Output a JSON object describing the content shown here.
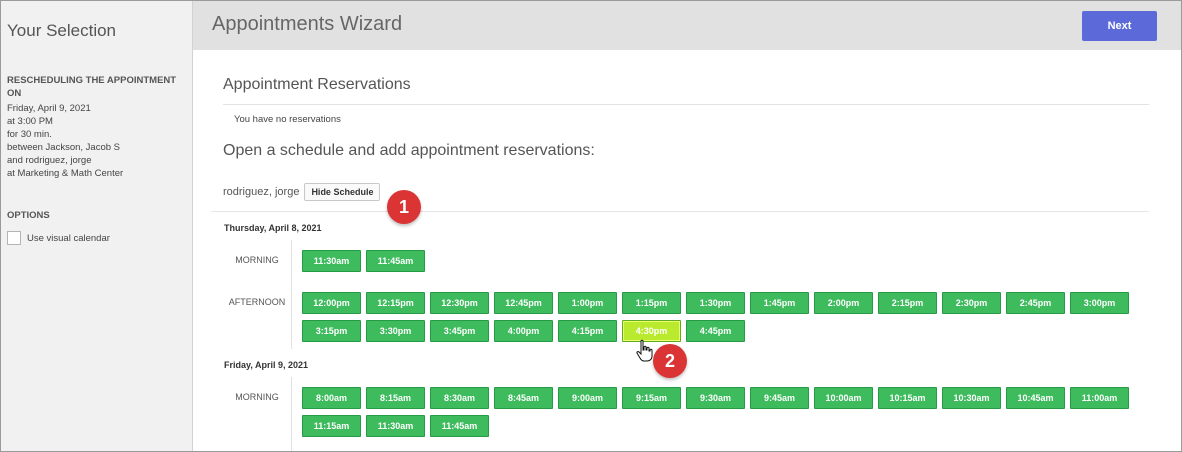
{
  "sidebar": {
    "title": "Your Selection",
    "rescheduling_heading": "RESCHEDULING THE APPOINTMENT ON",
    "details": [
      "Friday, April 9, 2021",
      "at 3:00 PM",
      "for 30 min.",
      "between Jackson, Jacob S",
      "and rodriguez, jorge",
      "at Marketing & Math Center"
    ],
    "options_heading": "OPTIONS",
    "visual_calendar_label": "Use visual calendar",
    "visual_calendar_checked": false
  },
  "header": {
    "title": "Appointments Wizard",
    "next_label": "Next"
  },
  "main": {
    "reservations_title": "Appointment Reservations",
    "no_reservations": "You have no reservations",
    "open_schedule_title": "Open a schedule and add appointment reservations:",
    "person_name": "rodriguez, jorge",
    "hide_schedule_label": "Hide Schedule"
  },
  "schedule": [
    {
      "date": "Thursday, April 8, 2021",
      "periods": [
        {
          "label": "MORNING",
          "slots": [
            "11:30am",
            "11:45am"
          ]
        },
        {
          "label": "AFTERNOON",
          "slots": [
            "12:00pm",
            "12:15pm",
            "12:30pm",
            "12:45pm",
            "1:00pm",
            "1:15pm",
            "1:30pm",
            "1:45pm",
            "2:00pm",
            "2:15pm",
            "2:30pm",
            "2:45pm",
            "3:00pm",
            "3:15pm",
            "3:30pm",
            "3:45pm",
            "4:00pm",
            "4:15pm",
            "4:30pm",
            "4:45pm"
          ]
        }
      ]
    },
    {
      "date": "Friday, April 9, 2021",
      "periods": [
        {
          "label": "MORNING",
          "slots": [
            "8:00am",
            "8:15am",
            "8:30am",
            "8:45am",
            "9:00am",
            "9:15am",
            "9:30am",
            "9:45am",
            "10:00am",
            "10:15am",
            "10:30am",
            "10:45am",
            "11:00am",
            "11:15am",
            "11:30am",
            "11:45am"
          ]
        }
      ]
    }
  ],
  "highlighted_slot": "4:30pm",
  "callouts": [
    "1",
    "2"
  ],
  "colors": {
    "slot_green": "#3dbb5d",
    "slot_highlight": "#b9ea2d",
    "next_button": "#5b6ad8",
    "callout_red": "#da3434"
  }
}
